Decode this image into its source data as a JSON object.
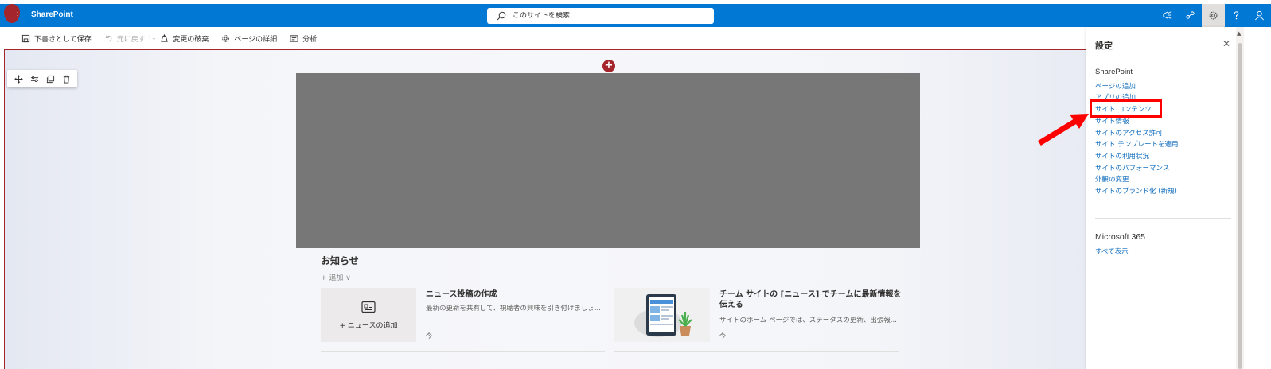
{
  "suitebar": {
    "brand": "SharePoint",
    "search_placeholder": "このサイトを検索",
    "icons": [
      "megaphone-icon",
      "share-icon",
      "gear-icon",
      "help-icon",
      "person-icon"
    ]
  },
  "commandbar": {
    "save_draft": "下書きとして保存",
    "undo": "元に戻す",
    "discard": "変更の破棄",
    "page_details": "ページの詳細",
    "analytics": "分析"
  },
  "news": {
    "title": "お知らせ",
    "add": "+ 追加 ∨",
    "card1": {
      "add_label": "+ ニュースの追加",
      "title": "ニュース投稿の作成",
      "desc": "最新の更新を共有して、視聴者の興味を引き付けましょ...",
      "foot": "今"
    },
    "card2": {
      "title_line1": "チーム サイトの [ニュース] でチームに最新情報を",
      "title_line2": "伝える",
      "desc": "サイトのホーム ページでは、ステータスの更新、出張報...",
      "foot": "今"
    }
  },
  "settings": {
    "title": "設定",
    "close": "✕",
    "section1": "SharePoint",
    "links": [
      "ページの追加",
      "アプリの追加",
      "サイト コンテンツ",
      "サイト情報",
      "サイトのアクセス許可",
      "サイト テンプレートを適用",
      "サイトの利用状況",
      "サイトのパフォーマンス",
      "外観の変更",
      "サイトのブランド化 (新規)"
    ],
    "section2": "Microsoft 365",
    "see_all": "すべて表示"
  },
  "colors": {
    "suitebar": "#0078d4",
    "accent_red": "#a4262c",
    "link": "#0f6cbd",
    "annotation": "#ff0000"
  }
}
